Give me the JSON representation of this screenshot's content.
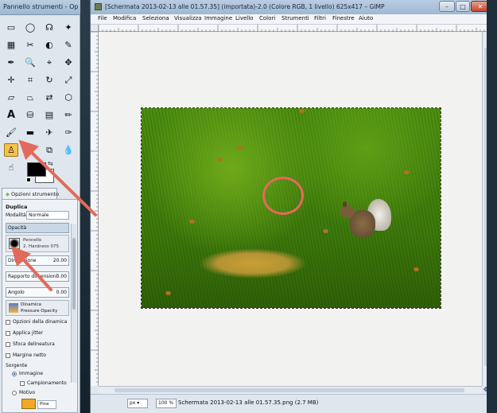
{
  "toolbox": {
    "title": "Pannello strumenti - Op...",
    "tab_label": "Opzioni strumento",
    "options": {
      "tool_name": "Duplica",
      "mode_label": "Modalità",
      "mode_value": "Normale",
      "opacity_label": "Opacità",
      "brush_label": "Pennello",
      "brush_name": "2. Hardness 075",
      "size_label": "Dimensione",
      "size_value": "20.00",
      "aspect_label": "Rapporto dimensioni",
      "aspect_value": "0.00",
      "angle_label": "Angolo",
      "angle_value": "0.00",
      "dynamics_label": "Dinamica",
      "dynamics_name": "Pressure Opacity",
      "dynamics_options": "Opzioni della dinamica",
      "jitter": "Applica jitter",
      "fade": "Sfoca delineatura",
      "hard_edge": "Margine netto",
      "source_label": "Sorgente",
      "source_image": "Immagine",
      "sample_merged": "Campionamento",
      "pattern": "Motivo",
      "pattern_name": "Pine"
    }
  },
  "image_window": {
    "title": "[Schermata 2013-02-13 alle 01.57.35] (importata)-2.0 (Colore RGB, 1 livello) 625x417 – GIMP",
    "window_buttons": {
      "minimize": "–",
      "maximize": "□",
      "close": "✕"
    },
    "menu": [
      "File",
      "Modifica",
      "Seleziona",
      "Visualizza",
      "Immagine",
      "Livello",
      "Colori",
      "Strumenti",
      "Filtri",
      "Finestre",
      "Aiuto"
    ],
    "status": {
      "unit": "px",
      "zoom": "100 %",
      "text": "Schermata 2013-02-13 alle 01.57.35.png (2.7 MB)"
    }
  },
  "colors": {
    "accent_red": "#e36a5a",
    "selected_tool": "#f6c14d"
  }
}
